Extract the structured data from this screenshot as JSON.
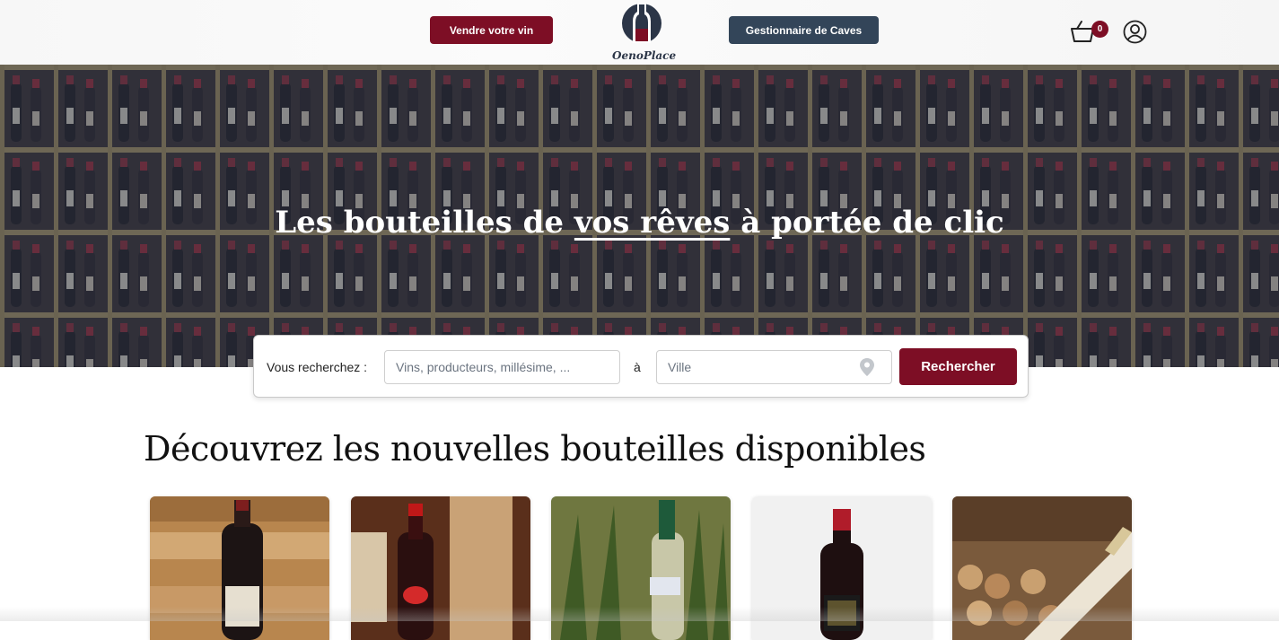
{
  "header": {
    "sell_label": "Vendre votre vin",
    "cellar_label": "Gestionnaire de Caves",
    "logo_text": "OenoPlace",
    "cart_count": "0",
    "icons": {
      "cart": "basket-icon",
      "user": "user-icon"
    }
  },
  "hero": {
    "title_part1": "Les bouteilles de ",
    "title_link": "vos rêves",
    "title_part2": " à portée de clic"
  },
  "search": {
    "label": "Vous recherchez :",
    "query_placeholder": "Vins, producteurs, millésime, ...",
    "separator": "à",
    "city_placeholder": "Ville",
    "button_label": "Rechercher"
  },
  "section": {
    "title": "Découvrez les nouvelles bouteilles disponibles"
  },
  "products": [
    {
      "image": "bottle-crate-photo"
    },
    {
      "image": "bottle-crate-photo"
    },
    {
      "image": "bottle-grass-photo"
    },
    {
      "image": "bottle-white-photo"
    },
    {
      "image": "bottle-corks-photo"
    }
  ],
  "colors": {
    "brand": "#7d0e25",
    "secondary": "#334559"
  }
}
